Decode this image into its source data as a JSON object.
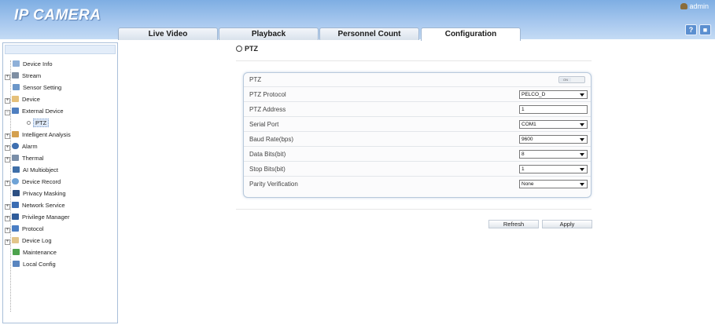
{
  "header": {
    "logo": "IP CAMERA",
    "user": "admin",
    "help_icon": "help-icon",
    "logout_icon": "logout-icon"
  },
  "tabs": [
    {
      "label": "Live Video"
    },
    {
      "label": "Playback"
    },
    {
      "label": "Personnel Count"
    },
    {
      "label": "Configuration",
      "active": true
    }
  ],
  "sidebar": {
    "items": [
      {
        "label": "Device Info",
        "icon": "device-info-icon"
      },
      {
        "label": "Stream",
        "icon": "stream-icon"
      },
      {
        "label": "Sensor Setting",
        "icon": "sensor-icon"
      },
      {
        "label": "Device",
        "icon": "device-icon"
      },
      {
        "label": "External Device",
        "icon": "external-device-icon"
      },
      {
        "label": "PTZ",
        "icon": "ptz-icon",
        "selected": true
      },
      {
        "label": "Intelligent Analysis",
        "icon": "analysis-icon"
      },
      {
        "label": "Alarm",
        "icon": "alarm-icon"
      },
      {
        "label": "Thermal",
        "icon": "thermal-icon"
      },
      {
        "label": "AI Multiobject",
        "icon": "ai-icon"
      },
      {
        "label": "Device Record",
        "icon": "record-icon"
      },
      {
        "label": "Privacy Masking",
        "icon": "privacy-icon"
      },
      {
        "label": "Network Service",
        "icon": "network-icon"
      },
      {
        "label": "Privilege Manager",
        "icon": "privilege-icon"
      },
      {
        "label": "Protocol",
        "icon": "protocol-icon"
      },
      {
        "label": "Device Log",
        "icon": "log-icon"
      },
      {
        "label": "Maintenance",
        "icon": "maintenance-icon"
      },
      {
        "label": "Local Config",
        "icon": "local-config-icon"
      }
    ]
  },
  "content": {
    "title": "PTZ",
    "rows": [
      {
        "label": "PTZ",
        "control": "toggle",
        "value": "ON"
      },
      {
        "label": "PTZ Protocol",
        "control": "select",
        "value": "PELCO_D"
      },
      {
        "label": "PTZ Address",
        "control": "input",
        "value": "1"
      },
      {
        "label": "Serial Port",
        "control": "select",
        "value": "COM1"
      },
      {
        "label": "Baud Rate(bps)",
        "control": "select",
        "value": "9600"
      },
      {
        "label": "Data Bits(bit)",
        "control": "select",
        "value": "8"
      },
      {
        "label": "Stop Bits(bit)",
        "control": "select",
        "value": "1"
      },
      {
        "label": "Parity Verification",
        "control": "select",
        "value": "None"
      }
    ],
    "refresh_label": "Refresh",
    "apply_label": "Apply"
  }
}
